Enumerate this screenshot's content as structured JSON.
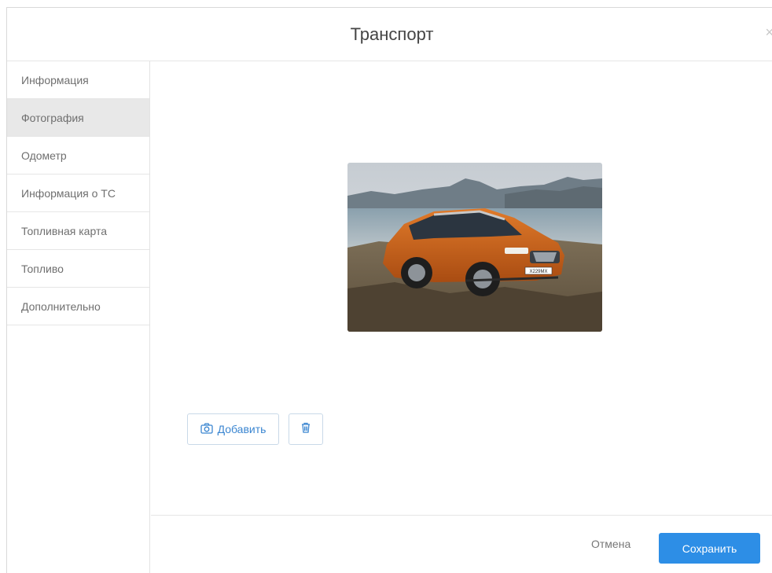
{
  "modal": {
    "title": "Транспорт",
    "close_label": "×"
  },
  "sidebar": {
    "items": [
      {
        "label": "Информация",
        "active": false
      },
      {
        "label": "Фотография",
        "active": true
      },
      {
        "label": "Одометр",
        "active": false
      },
      {
        "label": "Информация о ТС",
        "active": false
      },
      {
        "label": "Топливная карта",
        "active": false
      },
      {
        "label": "Топливо",
        "active": false
      },
      {
        "label": "Дополнительно",
        "active": false
      }
    ]
  },
  "photo": {
    "plate_text": "Х229МХ"
  },
  "actions": {
    "add_label": "Добавить",
    "add_icon": "camera-icon",
    "delete_icon": "trash-icon"
  },
  "footer": {
    "cancel_label": "Отмена",
    "save_label": "Сохранить"
  },
  "colors": {
    "accent": "#2d8ee6",
    "active_item_bg": "#e8e8e8",
    "button_border": "#c9d9e8"
  }
}
